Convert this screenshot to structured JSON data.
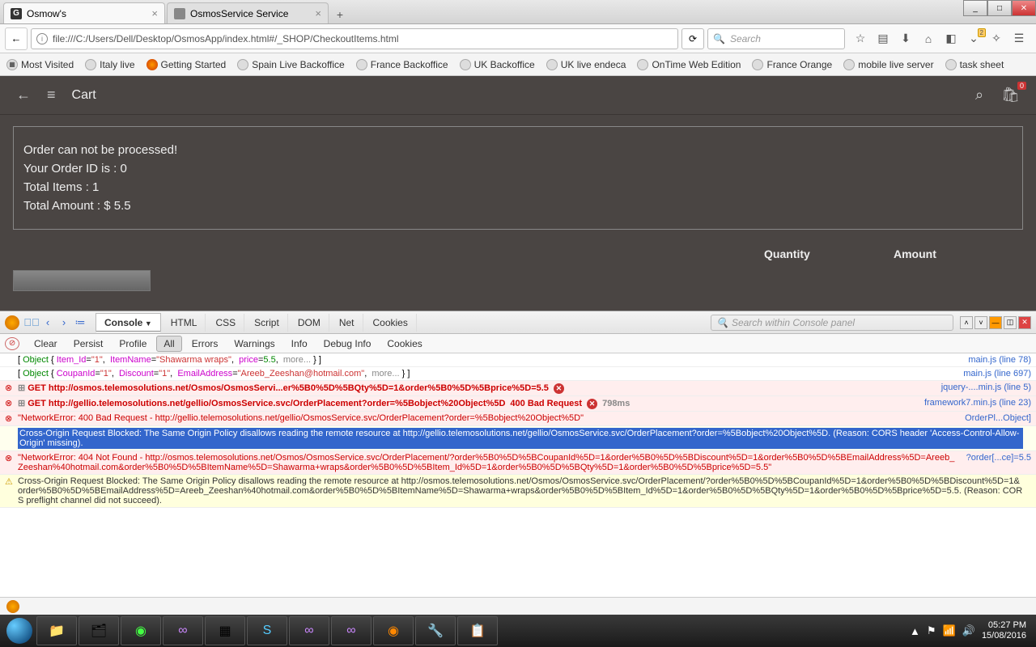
{
  "window": {
    "min": "_",
    "max": "□",
    "close": "✕"
  },
  "tabs": [
    {
      "favicon": "G",
      "title": "Osmow's"
    },
    {
      "favicon": "",
      "title": "OsmosService Service"
    }
  ],
  "url": "file:///C:/Users/Dell/Desktop/OsmosApp/index.html#/_SHOP/CheckoutItems.html",
  "search_placeholder": "Search",
  "bookmarks": [
    "Most Visited",
    "Italy live",
    "Getting Started",
    "Spain Live Backoffice",
    "France Backoffice",
    "UK Backoffice",
    "UK live endeca",
    "OnTime Web Edition",
    "France Orange",
    "mobile live server",
    "task sheet"
  ],
  "page": {
    "back": "←",
    "list": "≡",
    "title": "Cart",
    "searchIcon": "⌕",
    "bagIcon": "🛍",
    "bagCount": "0",
    "order": {
      "l1": "Order can not be processed!",
      "l2": "Your Order ID is : 0",
      "l3": "Total Items : 1",
      "l4": "Total Amount : $ 5.5"
    },
    "cols": {
      "qty": "Quantity",
      "amt": "Amount"
    }
  },
  "firebug": {
    "tabs": [
      "Console",
      "HTML",
      "CSS",
      "Script",
      "DOM",
      "Net",
      "Cookies"
    ],
    "activeTab": "Console",
    "search_placeholder": "Search within Console panel",
    "sub": [
      "Clear",
      "Persist",
      "Profile",
      "All",
      "Errors",
      "Warnings",
      "Info",
      "Debug Info",
      "Cookies"
    ],
    "activeSub": "All",
    "logs": [
      {
        "type": "obj",
        "text": "[ Object { Item_Id=\"1\",  ItemName=\"Shawarma wraps\",  price=5.5,  more... } ]",
        "src": "main.js (line 78)"
      },
      {
        "type": "obj",
        "text": "[ Object { CoupanId=\"1\",  Discount=\"1\",  EmailAddress=\"Areeb_Zeeshan@hotmail.com\",  more... } ]",
        "src": "main.js (line 697)"
      },
      {
        "type": "err",
        "text": "GET http://osmos.telemosolutions.net/Osmos/OsmosServi...er%5B0%5D%5BQty%5D=1&order%5B0%5D%5Bprice%5D=5.5",
        "badge": true,
        "src": "jquery-....min.js (line 5)"
      },
      {
        "type": "err",
        "text": "GET http://gellio.telemosolutions.net/gellio/OsmosService.svc/OrderPlacement?order=%5Bobject%20Object%5D",
        "status": "400 Bad Request",
        "badge": true,
        "time": "798ms",
        "src": "framework7.min.js (line 23)"
      },
      {
        "type": "nerr",
        "text": "\"NetworkError: 400 Bad Request - http://gellio.telemosolutions.net/gellio/OsmosService.svc/OrderPlacement?order=%5Bobject%20Object%5D\"",
        "src": "OrderPl...Object]"
      },
      {
        "type": "cors",
        "text": "Cross-Origin Request Blocked: The Same Origin Policy disallows reading the remote resource at http://gellio.telemosolutions.net/gellio/OsmosService.svc/OrderPlacement?order=%5Bobject%20Object%5D. (Reason: CORS header 'Access-Control-Allow-Origin' missing).",
        "src": ""
      },
      {
        "type": "nerr",
        "text": "\"NetworkError: 404 Not Found - http://osmos.telemosolutions.net/Osmos/OsmosService.svc/OrderPlacement/?order%5B0%5D%5BCoupanId%5D=1&order%5B0%5D%5BDiscount%5D=1&order%5B0%5D%5BEmailAddress%5D=Areeb_Zeeshan%40hotmail.com&order%5B0%5D%5BItemName%5D=Shawarma+wraps&order%5B0%5D%5BItem_Id%5D=1&order%5B0%5D%5BQty%5D=1&order%5B0%5D%5Bprice%5D=5.5\"",
        "src": "?order[...ce]=5.5"
      },
      {
        "type": "warn",
        "text": "Cross-Origin Request Blocked: The Same Origin Policy disallows reading the remote resource at http://osmos.telemosolutions.net/Osmos/OsmosService.svc/OrderPlacement/?order%5B0%5D%5BCoupanId%5D=1&order%5B0%5D%5BDiscount%5D=1&order%5B0%5D%5BEmailAddress%5D=Areeb_Zeeshan%40hotmail.com&order%5B0%5D%5BItemName%5D=Shawarma+wraps&order%5B0%5D%5BItem_Id%5D=1&order%5B0%5D%5BQty%5D=1&order%5B0%5D%5Bprice%5D=5.5. (Reason: CORS preflight channel did not succeed).",
        "src": ""
      }
    ]
  },
  "tray": {
    "time": "05:27 PM",
    "date": "15/08/2016"
  }
}
